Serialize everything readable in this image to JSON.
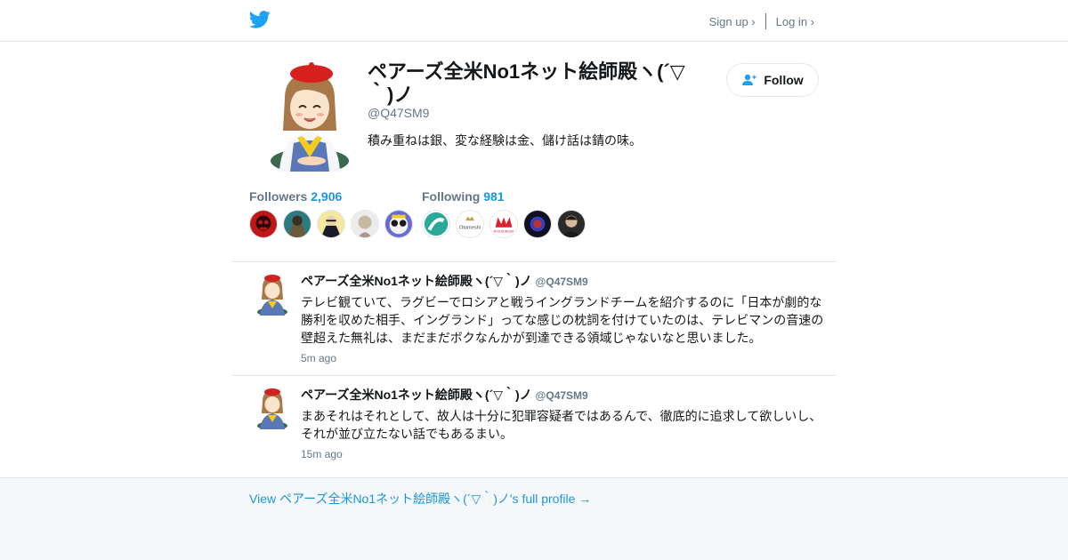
{
  "header": {
    "logo_icon": "twitter-bird-icon",
    "signup_label": "Sign up ›",
    "login_label": "Log in ›",
    "brand_color": "#1da1f2"
  },
  "profile": {
    "name": "ペアーズ全米No1ネット絵師殿ヽ(´▽｀)ノ",
    "handle": "@Q47SM9",
    "bio": "積み重ねは銀、変な経験は金、儲け話は錆の味。",
    "follow_label": "Follow",
    "followers_label": "Followers",
    "followers_count": "2,906",
    "following_label": "Following",
    "following_count": "981"
  },
  "tweets": [
    {
      "name": "ペアーズ全米No1ネット絵師殿ヽ(´▽｀)ノ",
      "handle": "@Q47SM9",
      "text": "テレビ観ていて、ラグビーでロシアと戦うイングランドチームを紹介するのに「日本が劇的な勝利を収めた相手、イングランド」ってな感じの枕詞を付けていたのは、テレビマンの音速の壁超えた無礼は、まだまだボクなんかが到達できる領域じゃないなと思いました。",
      "time": "5m ago"
    },
    {
      "name": "ペアーズ全米No1ネット絵師殿ヽ(´▽｀)ノ",
      "handle": "@Q47SM9",
      "text": "まあそれはそれとして、故人は十分に犯罪容疑者ではあるんで、徹底的に追求して欲しいし、それが並び立たない話でもあるまい。",
      "time": "15m ago"
    }
  ],
  "footer": {
    "link_text": "View ペアーズ全米No1ネット絵師殿ヽ(´▽｀)ノ's full profile →"
  },
  "thumbnail_logo_texts": {
    "otameshi": "Otameshi",
    "mos": "MOS BURGER"
  }
}
